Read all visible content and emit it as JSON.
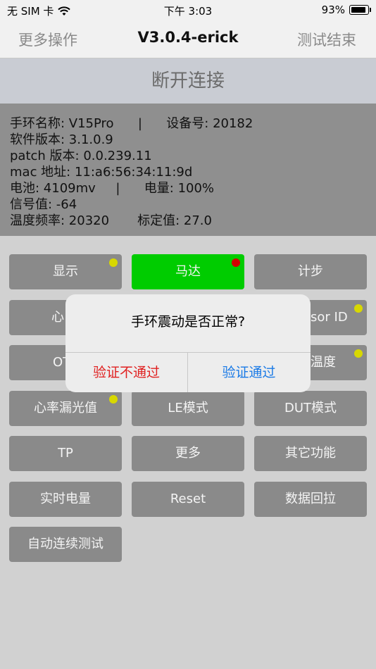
{
  "status_bar": {
    "carrier": "无 SIM 卡",
    "time": "下午 3:03",
    "battery": "93%",
    "battery_fraction": 0.93
  },
  "navbar": {
    "left": "更多操作",
    "title": "V3.0.4-erick",
    "right": "测试结束"
  },
  "disconnect_label": "断开连接",
  "info": {
    "line1": "手环名称: V15Pro      |      设备号: 20182",
    "line2": "软件版本: 3.1.0.9",
    "line3": "patch 版本: 0.0.239.11",
    "line4": "mac 地址: 11:a6:56:34:11:9d",
    "line5": "电池: 4109mv     |      电量: 100%",
    "line6": "信号值: -64",
    "line7": "温度频率: 20320       标定值: 27.0"
  },
  "buttons": {
    "display": "显示",
    "motor": "马达",
    "pedometer": "计步",
    "heart_rate_partial": "心",
    "sensor_id_partial": "sor ID",
    "ota_partial": "OT",
    "temperature_partial": "温度",
    "hr_leak": "心率漏光值",
    "le_mode": "LE模式",
    "dut_mode": "DUT模式",
    "tp": "TP",
    "more": "更多",
    "other": "其它功能",
    "realtime_power": "实时电量",
    "reset": "Reset",
    "data_pull": "数据回拉",
    "auto_test": "自动连续测试"
  },
  "alert": {
    "message": "手环震动是否正常?",
    "fail": "验证不通过",
    "pass": "验证通过"
  },
  "colors": {
    "green": "#00cc00",
    "yellow_dot": "#d8d800",
    "red_dot": "#d40000",
    "link_blue": "#1a7ae6",
    "danger_red": "#e02020"
  }
}
